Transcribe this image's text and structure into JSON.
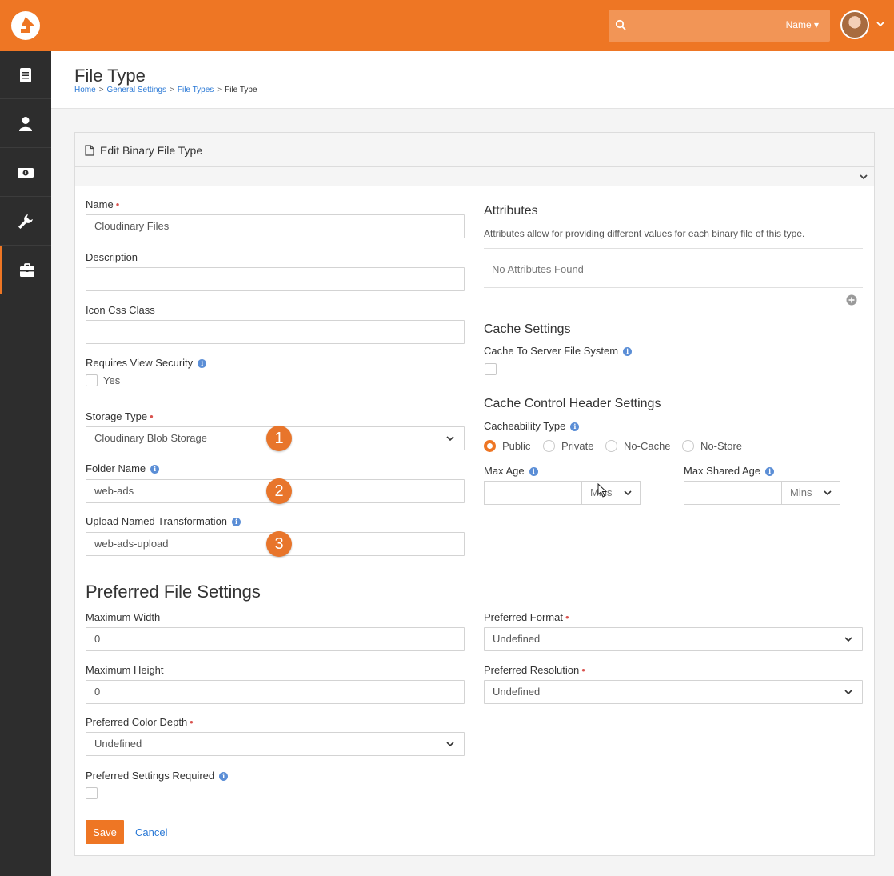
{
  "header": {
    "search_filter": "Name",
    "page_title": "File Type",
    "breadcrumb": [
      "Home",
      "General Settings",
      "File Types",
      "File Type"
    ]
  },
  "sidebar": {
    "items": [
      "page-icon",
      "person-icon",
      "money-icon",
      "wrench-icon",
      "briefcase-icon"
    ],
    "active_index": 4
  },
  "panel": {
    "title": "Edit Binary File Type"
  },
  "form": {
    "name_label": "Name",
    "name_value": "Cloudinary Files",
    "description_label": "Description",
    "description_value": "",
    "icon_css_label": "Icon Css Class",
    "icon_css_value": "",
    "requires_view_security_label": "Requires View Security",
    "requires_view_security_option": "Yes",
    "storage_type_label": "Storage Type",
    "storage_type_value": "Cloudinary Blob Storage",
    "folder_name_label": "Folder Name",
    "folder_name_value": "web-ads",
    "upload_transformation_label": "Upload Named Transformation",
    "upload_transformation_value": "web-ads-upload"
  },
  "callouts": [
    "1",
    "2",
    "3"
  ],
  "attributes": {
    "heading": "Attributes",
    "description": "Attributes allow for providing different values for each binary file of this type.",
    "empty_text": "No Attributes Found"
  },
  "cache": {
    "heading": "Cache Settings",
    "server_fs_label": "Cache To Server File System",
    "control_heading": "Cache Control Header Settings",
    "cacheability_label": "Cacheability Type",
    "options": [
      "Public",
      "Private",
      "No-Cache",
      "No-Store"
    ],
    "selected": "Public",
    "max_age_label": "Max Age",
    "max_age_unit": "Mins",
    "max_shared_age_label": "Max Shared Age",
    "max_shared_age_unit": "Mins"
  },
  "preferred": {
    "heading": "Preferred File Settings",
    "max_width_label": "Maximum Width",
    "max_width_value": "0",
    "max_height_label": "Maximum Height",
    "max_height_value": "0",
    "color_depth_label": "Preferred Color Depth",
    "color_depth_value": "Undefined",
    "format_label": "Preferred Format",
    "format_value": "Undefined",
    "resolution_label": "Preferred Resolution",
    "resolution_value": "Undefined",
    "settings_required_label": "Preferred Settings Required"
  },
  "actions": {
    "save_label": "Save",
    "cancel_label": "Cancel"
  },
  "colors": {
    "brand": "#ee7624",
    "sidebar": "#2d2d2d",
    "link": "#2c7ad6"
  }
}
